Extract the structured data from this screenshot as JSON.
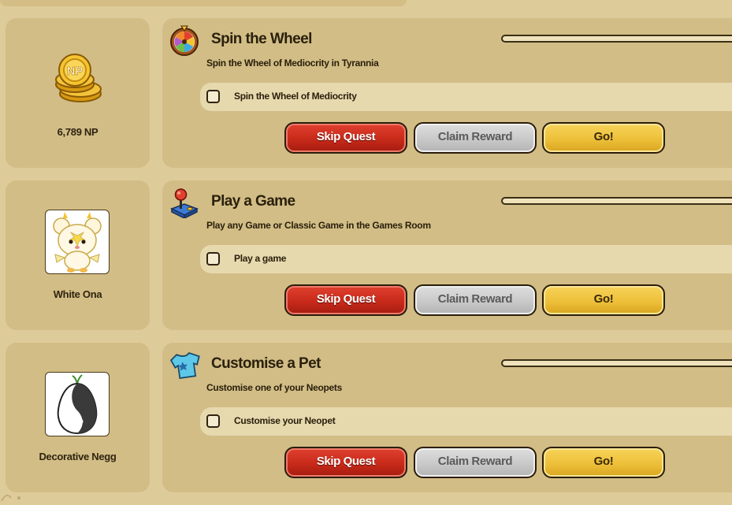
{
  "reward_coins": {
    "label": "6,789 NP",
    "icon": "np-coins-icon"
  },
  "quests": [
    {
      "icon": "prize-wheel-icon",
      "title": "Spin the Wheel",
      "description": "Spin the Wheel of Mediocrity in Tyrannia",
      "task_label": "Spin the Wheel of Mediocrity",
      "task_done": false,
      "progress": 0,
      "reward_label": "6,789 NP",
      "reward_icon": "np-coins-icon",
      "skip_label": "Skip Quest",
      "claim_label": "Claim Reward",
      "go_label": "Go!"
    },
    {
      "icon": "joystick-icon",
      "title": "Play a Game",
      "description": "Play any Game or Classic Game in the Games Room",
      "task_label": "Play a game",
      "task_done": false,
      "progress": 0,
      "reward_label": "White Ona",
      "reward_icon": "white-ona-petpet-image",
      "skip_label": "Skip Quest",
      "claim_label": "Claim Reward",
      "go_label": "Go!"
    },
    {
      "icon": "shirt-icon",
      "title": "Customise a Pet",
      "description": "Customise one of your Neopets",
      "task_label": "Customise your Neopet",
      "task_done": false,
      "progress": 0,
      "reward_label": "Decorative Negg",
      "reward_icon": "decorative-negg-image",
      "skip_label": "Skip Quest",
      "claim_label": "Claim Reward",
      "go_label": "Go!"
    }
  ],
  "colors": {
    "page_bg": "#decb9a",
    "card_bg": "#d2bd86",
    "skip_red": "#c82a1a",
    "claim_grey": "#c9c9c9",
    "go_yellow": "#eec03a"
  }
}
